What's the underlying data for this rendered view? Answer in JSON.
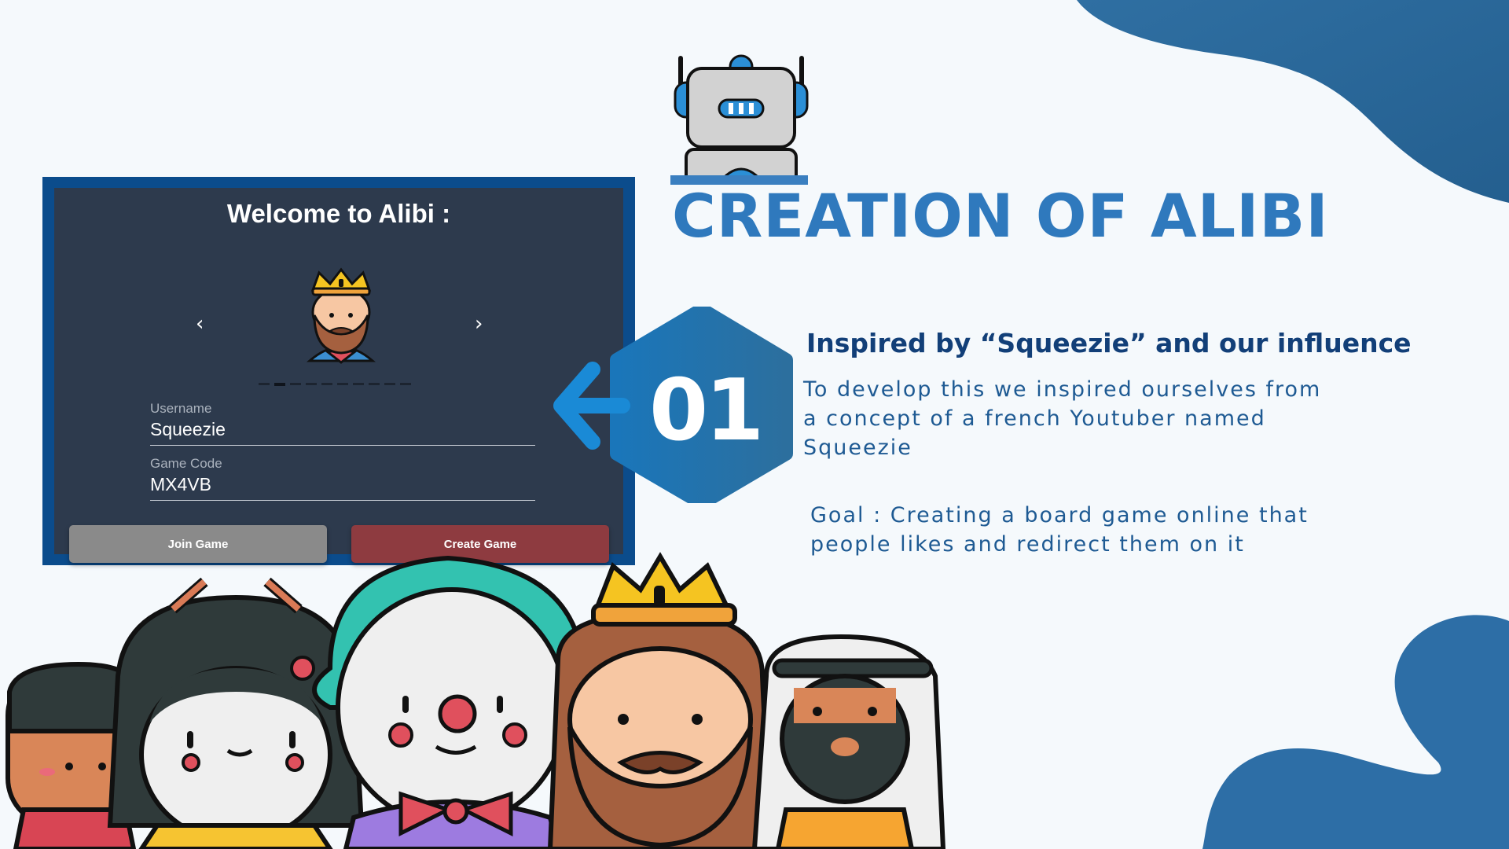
{
  "game": {
    "welcome": "Welcome to Alibi :",
    "prev_arrow": "‹",
    "next_arrow": "›",
    "username_label": "Username",
    "username_value": "Squeezie",
    "game_code_label": "Game Code",
    "game_code_value": "MX4VB",
    "join_button": "Join Game",
    "create_button": "Create Game"
  },
  "slide": {
    "title": "CREATION OF ALIBI",
    "number": "01",
    "subtitle": "Inspired by “Squeezie” and our influence",
    "paragraph1": "To develop this we inspired ourselves from a concept of a french Youtuber named Squeezie",
    "paragraph2": "Goal : Creating a board game online that people likes and redirect them on it"
  },
  "colors": {
    "accent": "#2f79bd",
    "dark_blue": "#123f78",
    "panel": "#2d3a4d",
    "join": "#8a8a8a",
    "create": "#8e3b40"
  }
}
